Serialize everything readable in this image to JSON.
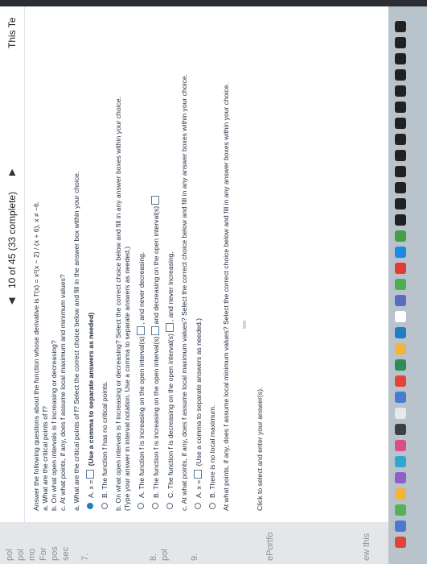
{
  "header": {
    "progress": "10 of 45 (33 complete)",
    "prev_arrow": "◀",
    "next_arrow": "▶",
    "right_tab": "This Te"
  },
  "side_fragments": [
    "pol",
    "pol",
    "mo",
    "For",
    "pos",
    "sec",
    "7.",
    "8.",
    "pol",
    "9.",
    "ePortfo",
    "ew this"
  ],
  "question": {
    "intro": "Answer the following questions about the function whose derivative is f′(x) =",
    "derivative": "x²(x − 2) / (x + 6), x ≠ −6.",
    "parts": [
      "a. What are the critical points of f?",
      "b. On what open intervals is f increasing or decreasing?",
      "c. At what points, if any, does f assume local maximum and minimum values?"
    ]
  },
  "part_a": {
    "prompt": "a. What are the critical points of f? Select the correct choice below and fill in the answer box within your choice.",
    "option_a_prefix": "A.  x =",
    "option_a_note": "(Use a comma to separate answers as needed)",
    "option_b": "B.  The function f has no critical points."
  },
  "part_b": {
    "prompt": "b. On what open intervals is f increasing or decreasing? Select the correct choice below and fill in any answer boxes within your choice.",
    "note": "(Type your answer in interval notation. Use a comma to separate answers as needed.)",
    "option_a_1": "A.  The function f is increasing on the open interval(s)",
    "option_a_2": ", and never decreasing.",
    "option_b_1": "B.  The function f is increasing on the open interval(s)",
    "option_b_2": "and decreasing on the open interval(s)",
    "option_c_1": "C.  The function f is decreasing on the open interval(s)",
    "option_c_2": ", and never increasing."
  },
  "part_c": {
    "prompt": "c. At what points, if any, does f assume local maximum values? Select the correct choice below and fill in any answer boxes within your choice.",
    "option_a_prefix": "A.  x =",
    "option_a_note": "(Use a comma to separate answers as needed.)",
    "option_b": "B.  There is no local maximum.",
    "prompt2": "At what points, if any, does f assume local minimum values? Select the correct choice below and fill in any answer boxes within your choice."
  },
  "footer": {
    "click_text": "Click to select and enter your answer(s)."
  },
  "colors": {
    "selected_radio": "#1d7fc1",
    "page_bg": "#ffffff",
    "dock": "#b9c3cc"
  }
}
